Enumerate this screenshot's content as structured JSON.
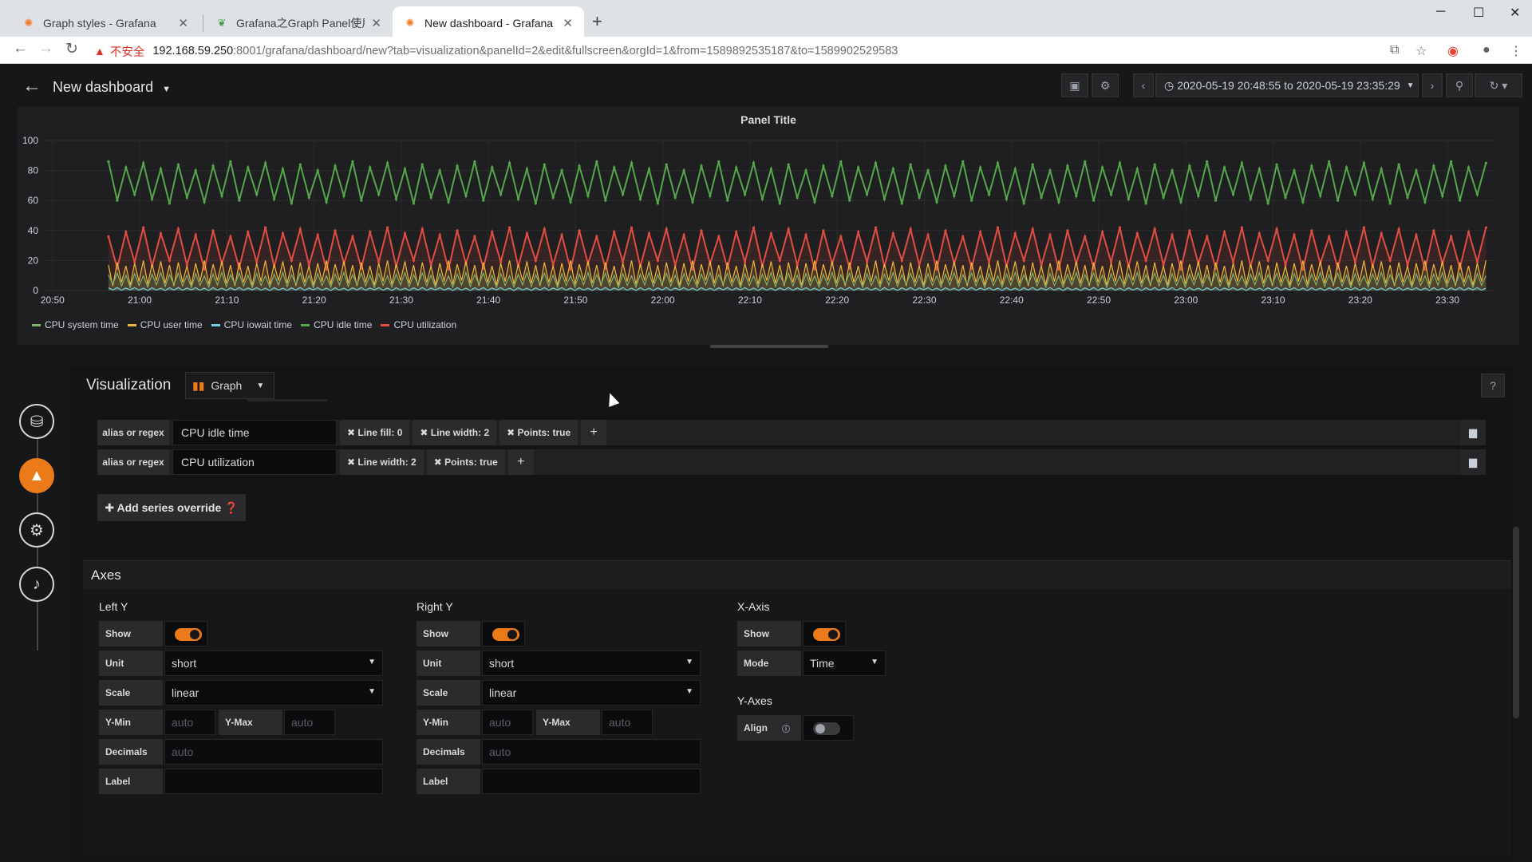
{
  "browser": {
    "tabs": [
      {
        "title": "Graph styles - Grafana",
        "icon": "grafana-icon",
        "color": "#f47b20"
      },
      {
        "title": "Grafana之Graph Panel使用(翻…",
        "icon": "leaf-icon",
        "color": "#3fa34d"
      },
      {
        "title": "New dashboard - Grafana",
        "icon": "grafana-icon",
        "color": "#f47b20"
      }
    ],
    "security_label": "不安全",
    "url_host": "192.168.59.250",
    "url_rest": ":8001/grafana/dashboard/new?tab=visualization&panelId=2&edit&fullscreen&orgId=1&from=1589892535187&to=1589902529583"
  },
  "dashboard": {
    "title": "New dashboard",
    "time_range": "2020-05-19 20:48:55 to 2020-05-19 23:35:29"
  },
  "panel": {
    "title": "Panel Title",
    "legend": [
      {
        "name": "CPU system time",
        "color": "#7eb26d"
      },
      {
        "name": "CPU user time",
        "color": "#eab839"
      },
      {
        "name": "CPU iowait time",
        "color": "#6ed0e0"
      },
      {
        "name": "CPU idle time",
        "color": "#56a64b"
      },
      {
        "name": "CPU utilization",
        "color": "#e24d42"
      }
    ]
  },
  "chart_data": {
    "type": "line",
    "ylim": [
      0,
      100
    ],
    "yticks": [
      0,
      20,
      40,
      60,
      80,
      100
    ],
    "xticks": [
      "20:50",
      "21:00",
      "21:10",
      "21:20",
      "21:30",
      "21:40",
      "21:50",
      "22:00",
      "22:10",
      "22:20",
      "22:30",
      "22:40",
      "22:50",
      "23:00",
      "23:10",
      "23:20",
      "23:30"
    ],
    "x_range": [
      "20:48:55",
      "23:35:29"
    ],
    "series": [
      {
        "name": "CPU idle time",
        "color": "#56a64b",
        "low": 58,
        "high": 86,
        "period_min": 2
      },
      {
        "name": "CPU utilization",
        "color": "#e24d42",
        "low": 14,
        "high": 42,
        "period_min": 2
      },
      {
        "name": "CPU user time",
        "color": "#eab839",
        "low": 3,
        "high": 20,
        "period_min": 1
      },
      {
        "name": "CPU system time",
        "color": "#7eb26d",
        "low": 2,
        "high": 12,
        "period_min": 1
      },
      {
        "name": "CPU iowait time",
        "color": "#6ed0e0",
        "low": 0,
        "high": 2,
        "period_min": 1
      }
    ]
  },
  "editor": {
    "visualization_label": "Visualization",
    "viz_type": "Graph",
    "help": "?",
    "overrides": [
      {
        "label": "alias or regex",
        "value": "CPU idle time",
        "pills": [
          "✖ Line fill: 0",
          "✖ Line width: 2",
          "✖ Points: true"
        ]
      },
      {
        "label": "alias or regex",
        "value": "CPU utilization",
        "pills": [
          "✖ Line width: 2",
          "✖ Points: true"
        ]
      }
    ],
    "add_override": "✚ Add series override ❓",
    "axes_title": "Axes",
    "left_y": {
      "title": "Left Y",
      "show": "Show",
      "unit_label": "Unit",
      "unit": "short",
      "scale_label": "Scale",
      "scale": "linear",
      "ymin_label": "Y-Min",
      "ymin_placeholder": "auto",
      "ymax_label": "Y-Max",
      "ymax_placeholder": "auto",
      "decimals_label": "Decimals",
      "decimals_placeholder": "auto",
      "label_label": "Label"
    },
    "right_y": {
      "title": "Right Y",
      "show": "Show",
      "unit_label": "Unit",
      "unit": "short",
      "scale_label": "Scale",
      "scale": "linear",
      "ymin_label": "Y-Min",
      "ymin_placeholder": "auto",
      "ymax_label": "Y-Max",
      "ymax_placeholder": "auto",
      "decimals_label": "Decimals",
      "decimals_placeholder": "auto",
      "label_label": "Label"
    },
    "x_axis": {
      "title": "X-Axis",
      "show": "Show",
      "mode_label": "Mode",
      "mode": "Time"
    },
    "y_axes": {
      "title": "Y-Axes",
      "align_label": "Align"
    }
  }
}
